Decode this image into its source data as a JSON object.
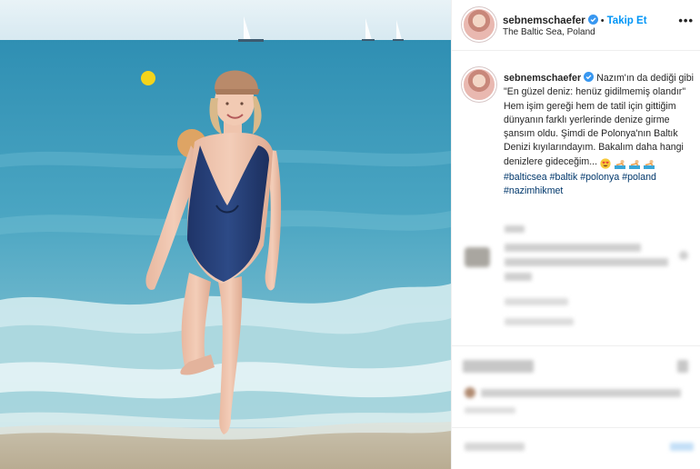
{
  "post": {
    "username": "sebnemschaefer",
    "follow_label": "Takip Et",
    "location": "The Baltic Sea, Poland",
    "more_label": "•••"
  },
  "caption": {
    "text": "Nazım'ın da dediği gibi \"En güzel deniz: henüz gidilmemiş olandır\" Hem işim gereği hem de tatil için gittiğim dünyanın farklı yerlerinde denize girme şansım oldu. Şimdi de Polonya'nın Baltık Denizi kıyılarındayım. Bakalım daha hangi denizlere gideceğim...",
    "hashtags": [
      "#balticsea",
      "#baltik",
      "#polonya",
      "#poland",
      "#nazimhikmet"
    ]
  },
  "icons": {
    "verified": "verified-badge-icon",
    "emoji_1": "heart-eyes-emoji",
    "emoji_2": "swimmer-emoji",
    "more": "more-options-icon"
  },
  "colors": {
    "accent": "#0095f6",
    "hashtag": "#00376b",
    "text": "#262626",
    "verified": "#3897f0"
  }
}
